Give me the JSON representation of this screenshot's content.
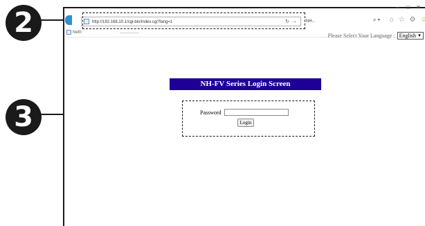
{
  "callouts": {
    "step_a": "2",
    "step_b": "3"
  },
  "browser": {
    "address_url": "http://192.168.10.1/cgi-bin/index.cgi?lang=1",
    "tab_title": "NH...",
    "favorites_tab": "Neth",
    "refresh_glyph": "↻",
    "go_glyph": "→",
    "search_glyph": "⌕ ▾",
    "toolbar_icons": "⌂ ☆ ⚙",
    "smiley_glyph": "☺",
    "window_controls": {
      "minimize": "–",
      "maximize": "□",
      "close": "✕"
    }
  },
  "page": {
    "language_prompt": "Please Select Your Language :",
    "language_selected": "English",
    "language_arrow": "▼",
    "title": "NH-FV Series Login Screen",
    "password_label": "Password",
    "password_value": "",
    "login_label": "Login"
  },
  "colors": {
    "title_bg": "#1e0096",
    "badge_bg": "#1a1a1a"
  }
}
